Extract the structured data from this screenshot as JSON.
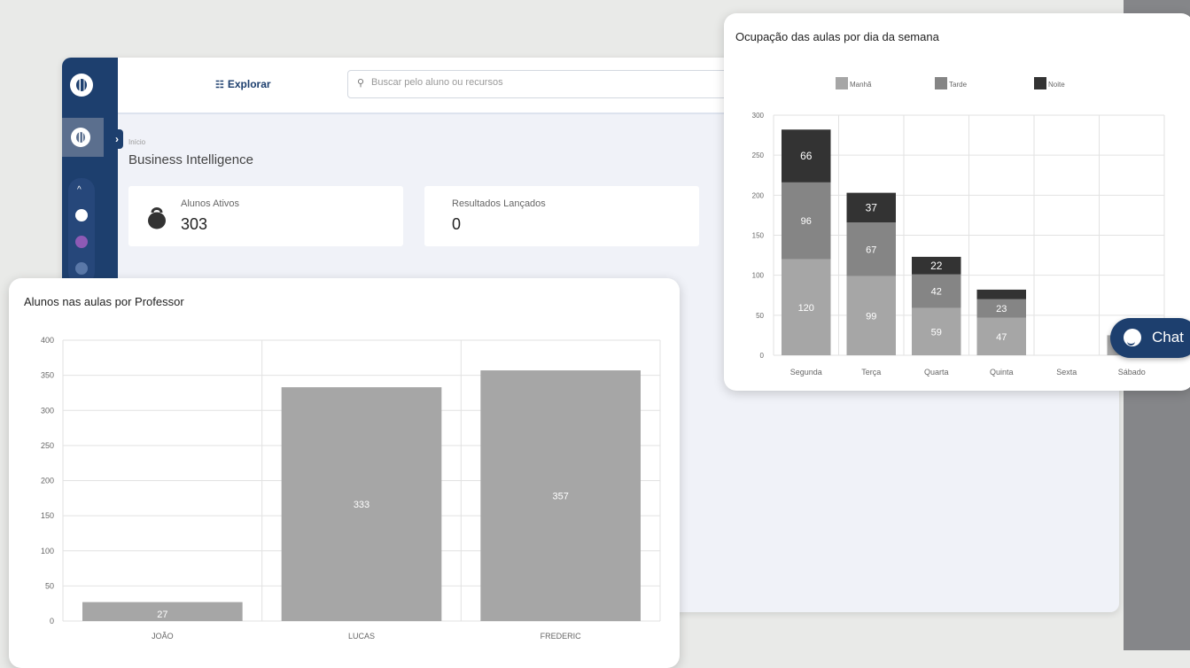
{
  "topbar": {
    "explore_label": "Explorar",
    "search_placeholder": "Buscar pelo aluno ou recursos"
  },
  "breadcrumb": "Início",
  "page_title": "Business Intelligence",
  "kpis": [
    {
      "label": "Alunos Ativos",
      "value": "303"
    },
    {
      "label": "Resultados Lançados",
      "value": "0"
    }
  ],
  "chat": {
    "label": "Chat"
  },
  "colors": {
    "sidebar": "#1d3f6e",
    "bar": "#a6a6a6",
    "manha": "#a6a6a6",
    "tarde": "#858585",
    "noite": "#333333"
  },
  "chart_data": [
    {
      "type": "bar",
      "title": "Alunos nas aulas por Professor",
      "categories": [
        "JOÃO",
        "LUCAS",
        "FREDERIC"
      ],
      "values": [
        27,
        333,
        357
      ],
      "ylim": [
        0,
        400
      ],
      "yticks": [
        "0",
        "50",
        "100",
        "150",
        "200",
        "250",
        "300",
        "350",
        "400"
      ],
      "grid": true
    },
    {
      "type": "bar",
      "stacked": true,
      "title": "Ocupação das aulas por dia da semana",
      "categories": [
        "Segunda",
        "Terça",
        "Quarta",
        "Quinta",
        "Sexta",
        "Sábado"
      ],
      "series": [
        {
          "name": "Manhã",
          "values": [
            120,
            99,
            59,
            47,
            0,
            25
          ]
        },
        {
          "name": "Tarde",
          "values": [
            96,
            67,
            42,
            23,
            0,
            0
          ]
        },
        {
          "name": "Noite",
          "values": [
            66,
            37,
            22,
            12,
            0,
            0
          ]
        }
      ],
      "data_labels": [
        [
          "120",
          "99",
          "59",
          "47",
          "",
          ""
        ],
        [
          "96",
          "67",
          "42",
          "23",
          "",
          ""
        ],
        [
          "66",
          "37",
          "22",
          "",
          "",
          ""
        ]
      ],
      "ylim": [
        0,
        300
      ],
      "yticks": [
        "0",
        "50",
        "100",
        "150",
        "200",
        "250",
        "300"
      ],
      "legend": "top",
      "grid": true
    }
  ]
}
